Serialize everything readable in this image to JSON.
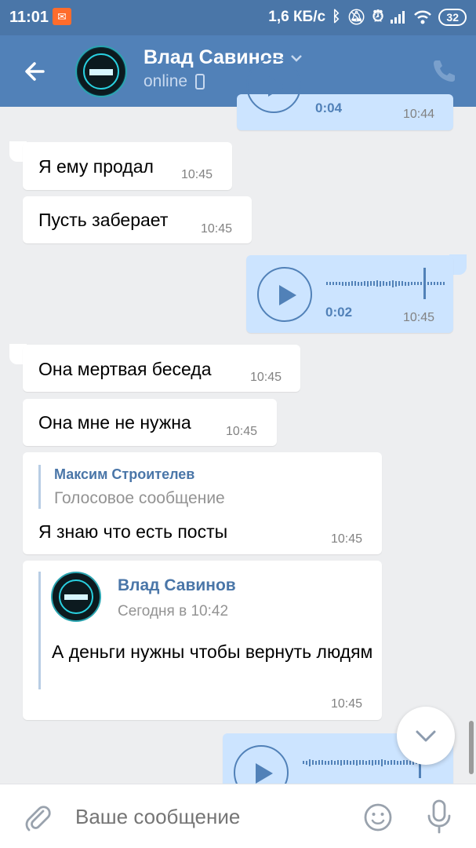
{
  "status_bar": {
    "time": "11:01",
    "speed": "1,6 КБ/с",
    "battery": "32"
  },
  "header": {
    "contact_name": "Влад Савинов",
    "status": "online",
    "icons": [
      "back-arrow-icon",
      "chevron-down-icon",
      "mobile-icon",
      "phone-icon"
    ]
  },
  "messages": [
    {
      "direction": "out",
      "type": "voice",
      "duration": "0:04",
      "time": "10:44"
    },
    {
      "direction": "in",
      "text": "Я ему продал",
      "time": "10:45"
    },
    {
      "direction": "in",
      "text": "Пусть заберает",
      "time": "10:45"
    },
    {
      "direction": "out",
      "type": "voice",
      "duration": "0:02",
      "time": "10:45"
    },
    {
      "direction": "in",
      "text": "Она мертвая беседа",
      "time": "10:45"
    },
    {
      "direction": "in",
      "text": "Она мне не нужна",
      "time": "10:45"
    },
    {
      "direction": "in",
      "reply_author": "Максим Строителев",
      "reply_text": "Голосовое сообщение",
      "text": "Я знаю что есть посты",
      "time": "10:45"
    },
    {
      "direction": "in",
      "forward_author": "Влад Савинов",
      "forward_date": "Сегодня в 10:42",
      "forward_text": "А деньги нужны чтобы вернуть людям",
      "time": "10:45"
    },
    {
      "direction": "out",
      "type": "voice"
    }
  ],
  "composer": {
    "placeholder": "Ваше сообщение",
    "icons": [
      "attach-icon",
      "emoji-icon",
      "microphone-icon"
    ]
  },
  "colors": {
    "header": "#5181b8",
    "status_bar": "#4a76a8",
    "background": "#edeef0",
    "outgoing_bubble": "#cce4ff",
    "incoming_bubble": "#ffffff",
    "accent": "#5181b8"
  }
}
